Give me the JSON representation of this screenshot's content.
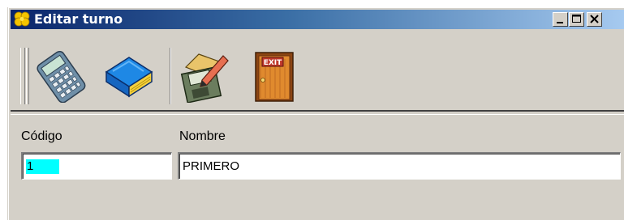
{
  "window": {
    "title": "Editar turno",
    "controls": [
      "minimize-icon",
      "maximize-icon",
      "close-icon"
    ]
  },
  "toolbar": {
    "buttons": [
      {
        "name": "calculator",
        "icon": "calculator-icon"
      },
      {
        "name": "book",
        "icon": "book-icon"
      },
      {
        "name": "save-edit",
        "icon": "edit-save-icon"
      },
      {
        "name": "exit",
        "icon": "exit-door-icon",
        "sign_text": "EXIT"
      }
    ]
  },
  "form": {
    "codigo": {
      "label": "Código",
      "value": "1"
    },
    "nombre": {
      "label": "Nombre",
      "value": "PRIMERO"
    }
  },
  "colors": {
    "titlebar_start": "#0a246a",
    "titlebar_end": "#a6caf0",
    "window_bg": "#d4d0c8",
    "selection": "#00ffff"
  }
}
